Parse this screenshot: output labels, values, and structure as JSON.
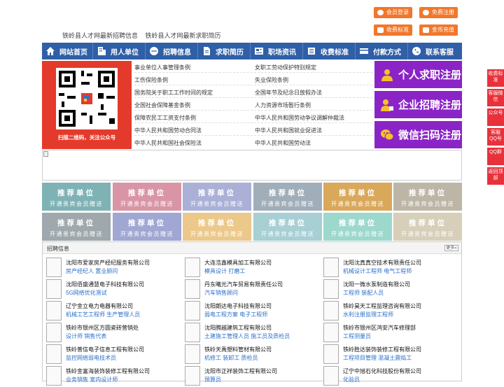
{
  "top_buttons": {
    "member_login": "会员登录",
    "free_register": "免费注册",
    "fee_standard": "收费标准",
    "coin_recharge": "金币充值"
  },
  "top_links": [
    "铁岭县人才网最新招聘信息",
    "铁岭县人才网最新求职简历"
  ],
  "nav": [
    "网站首页",
    "用人单位",
    "招聘信息",
    "求职简历",
    "职场资讯",
    "收费标准",
    "付款方式",
    "联系客服"
  ],
  "qr_caption": "扫描二维码，关注公众号",
  "links_left": [
    "事业单位人事管理条例",
    "工伤保险条例",
    "国务院关于职工工作时间的规定",
    "全国社会保障基金条例",
    "保障农民工工资支付条例",
    "中华人民共和国劳动合同法",
    "中华人民共和国社会保险法"
  ],
  "links_right": [
    "女职工劳动保护特别规定",
    "失业保险条例",
    "全国年节及纪念日放假办法",
    "人力资源市场暂行条例",
    "中华人民共和国劳动争议调解仲裁法",
    "中华人民共和国就业促进法",
    "中华人民共和国劳动法"
  ],
  "purple_buttons": [
    "个人求职注册",
    "企业招聘注册",
    "微信扫码注册"
  ],
  "recommend": {
    "title": "推荐单位",
    "subtitle": "开通贵宾会员赠送"
  },
  "recommend_colors": [
    "#7fb2b5",
    "#d995a6",
    "#aab0d6",
    "#a0aeb9",
    "#d9a85b",
    "#bdb6a7",
    "#9fa8ac",
    "#a0a7d2",
    "#ecc98a",
    "#a7cfd4",
    "#9dd8cd",
    "#d7cfb9"
  ],
  "jobs": {
    "title": "招聘信息",
    "more": "更多»",
    "items": [
      {
        "company": "沈阳市爱家房产经纪服务有限公司",
        "positions": "房产经纪人 置业顾问"
      },
      {
        "company": "大连浩鑫模具加工有限公司",
        "positions": "模具设计 打磨工"
      },
      {
        "company": "沈阳沈真真空技术有限责任公司",
        "positions": "机械设计工程师 电气工程师"
      },
      {
        "company": "沈阳佰盛通慧电子科技有限公司",
        "positions": "5G网络优化测试"
      },
      {
        "company": "丹东曦光汽车贸易有限责任公司",
        "positions": "汽车销售顾问"
      },
      {
        "company": "沈阳一微水泵制造有限公司",
        "positions": "工程师 装配人员"
      },
      {
        "company": "辽宁金立电力电器有限公司",
        "positions": "机械工艺工程师 生产管理人员"
      },
      {
        "company": "沈阳朗达电子科技有限公司",
        "positions": "弱电工程方案 电子工程师"
      },
      {
        "company": "铁岭昊天工程监理咨询有限公司",
        "positions": "水利注册监理工程师"
      },
      {
        "company": "铁岭市银州区方圆瓷砖营销处",
        "positions": "设计师 销售代表"
      },
      {
        "company": "沈阳腾越建筑工程有限公司",
        "positions": "土建施工管理人员 施工员及质检员"
      },
      {
        "company": "铁岭市银州区鸿安汽车修理部",
        "positions": "工程测量员"
      },
      {
        "company": "铁岭普信电子信息工程有限公司",
        "positions": "监控网络弱电技术员"
      },
      {
        "company": "铁岭天禹塑料管材有限公司",
        "positions": "机修工 装卸工 质检员"
      },
      {
        "company": "铁岭胜达装饰装修工程有限公司",
        "positions": "工程项目管理 混凝土震捣工"
      },
      {
        "company": "铁岭金富海装饰装修工程有限公司",
        "positions": "业务销售 室内设计师"
      },
      {
        "company": "沈阳市正祥装饰工程有限公司",
        "positions": "预算员"
      },
      {
        "company": "辽宁中旭石化科技股份有限公司",
        "positions": "化验员"
      }
    ]
  },
  "right_float": [
    "收费标准",
    "客服微信",
    "公众号",
    "客服QQ号",
    "QQ群",
    "返回顶部"
  ]
}
